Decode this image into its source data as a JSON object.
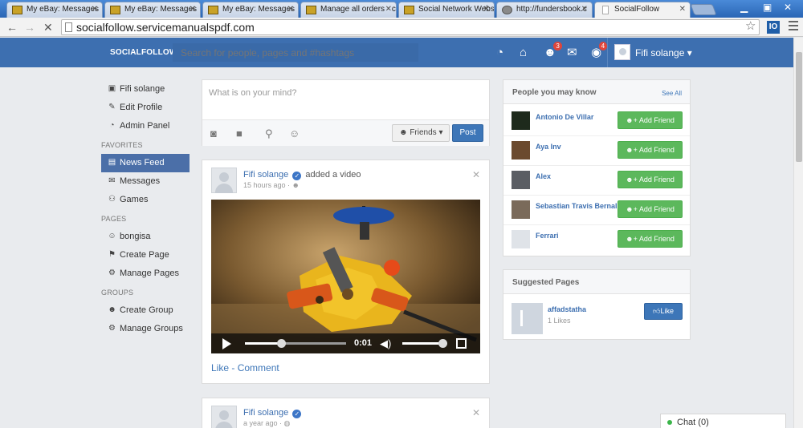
{
  "browser": {
    "tabs": [
      {
        "title": "My eBay: Messages",
        "icon": "ebay-favicon",
        "active": false
      },
      {
        "title": "My eBay: Messages",
        "icon": "ebay-favicon",
        "active": false
      },
      {
        "title": "My eBay: Messages",
        "icon": "ebay-favicon",
        "active": false
      },
      {
        "title": "Manage all orders - c",
        "icon": "ebay-favicon",
        "active": false
      },
      {
        "title": "Social Network Webs",
        "icon": "ebay-favicon",
        "active": false
      },
      {
        "title": "http://fundersbook.c",
        "icon": "globe-favicon",
        "active": false
      },
      {
        "title": "SocialFollow",
        "icon": "page-favicon",
        "active": true
      }
    ],
    "url": "socialfollow.servicemanualspdf.com",
    "extension_label": "IO"
  },
  "header": {
    "brand": "SOCIALFOLLOW",
    "search_placeholder": "Search for people, pages and #hashtags",
    "friend_requests_count": "3",
    "notifications_count": "4",
    "user_name": "Fifi solange"
  },
  "sidebar": {
    "profile": [
      {
        "label": "Fifi solange",
        "icon": "avatar-icon"
      },
      {
        "label": "Edit Profile",
        "icon": "edit-icon"
      },
      {
        "label": "Admin Panel",
        "icon": "dashboard-icon"
      }
    ],
    "favorites_heading": "FAVORITES",
    "favorites": [
      {
        "label": "News Feed",
        "icon": "newsfeed-icon",
        "active": true
      },
      {
        "label": "Messages",
        "icon": "comments-icon"
      },
      {
        "label": "Games",
        "icon": "gamepad-icon"
      }
    ],
    "pages_heading": "PAGES",
    "pages": [
      {
        "label": "bongisa",
        "icon": "page-avatar-icon"
      },
      {
        "label": "Create Page",
        "icon": "flag-icon"
      },
      {
        "label": "Manage Pages",
        "icon": "manage-icon"
      }
    ],
    "groups_heading": "GROUPS",
    "groups": [
      {
        "label": "Create Group",
        "icon": "group-icon"
      },
      {
        "label": "Manage Groups",
        "icon": "manage-icon"
      }
    ]
  },
  "composer": {
    "placeholder": "What is on your mind?",
    "privacy": "Friends",
    "post_label": "Post"
  },
  "posts": [
    {
      "author": "Fifi solange",
      "action": "added a video",
      "time": "15 hours ago",
      "video_time": "0:01",
      "video_progress": 0.36,
      "like_label": "Like",
      "separator": "-",
      "comment_label": "Comment"
    },
    {
      "author": "Fifi solange",
      "time": "a year ago"
    }
  ],
  "people": {
    "title": "People you may know",
    "see_all": "See All",
    "add_label": "Add Friend",
    "items": [
      {
        "name": "Antonio De Villar"
      },
      {
        "name": "Aya Inv"
      },
      {
        "name": "Alex"
      },
      {
        "name": "Sebastian Travis Bernal"
      },
      {
        "name": "Ferrari"
      }
    ]
  },
  "suggested": {
    "title": "Suggested Pages",
    "page_name": "affadstatha",
    "likes": "1 Likes",
    "like_label": "Like"
  },
  "chat": {
    "label": "Chat (0)"
  }
}
